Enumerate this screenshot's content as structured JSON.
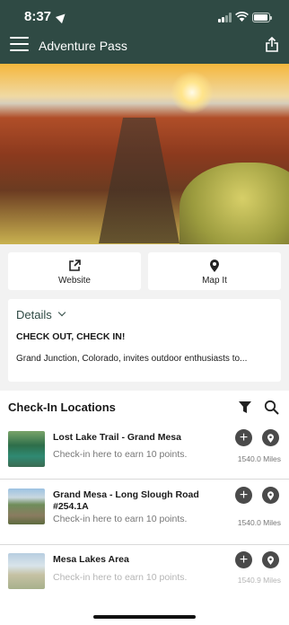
{
  "status_bar": {
    "time": "8:37"
  },
  "header": {
    "title": "Adventure Pass"
  },
  "actions": [
    {
      "label": "Website",
      "icon": "external-link-icon"
    },
    {
      "label": "Map It",
      "icon": "map-pin-icon"
    }
  ],
  "details": {
    "heading": "Details",
    "title": "CHECK OUT, CHECK IN!",
    "body": "Grand Junction, Colorado, invites outdoor enthusiasts to..."
  },
  "checkin": {
    "title": "Check-In Locations",
    "items": [
      {
        "name": "Lost Lake Trail - Grand Mesa",
        "subtitle": "Check-in here to earn 10 points.",
        "distance": "1540.0 Miles"
      },
      {
        "name": "Grand Mesa - Long Slough Road #254.1A",
        "subtitle": "Check-in here to earn 10 points.",
        "distance": "1540.0 Miles"
      },
      {
        "name": "Mesa Lakes Area",
        "subtitle": "Check-in here to earn 10 points.",
        "distance": "1540.9 Miles"
      }
    ]
  },
  "colors": {
    "header": "#2f4a44",
    "accent": "#2f4a44",
    "button_dark": "#4a4a4a"
  }
}
